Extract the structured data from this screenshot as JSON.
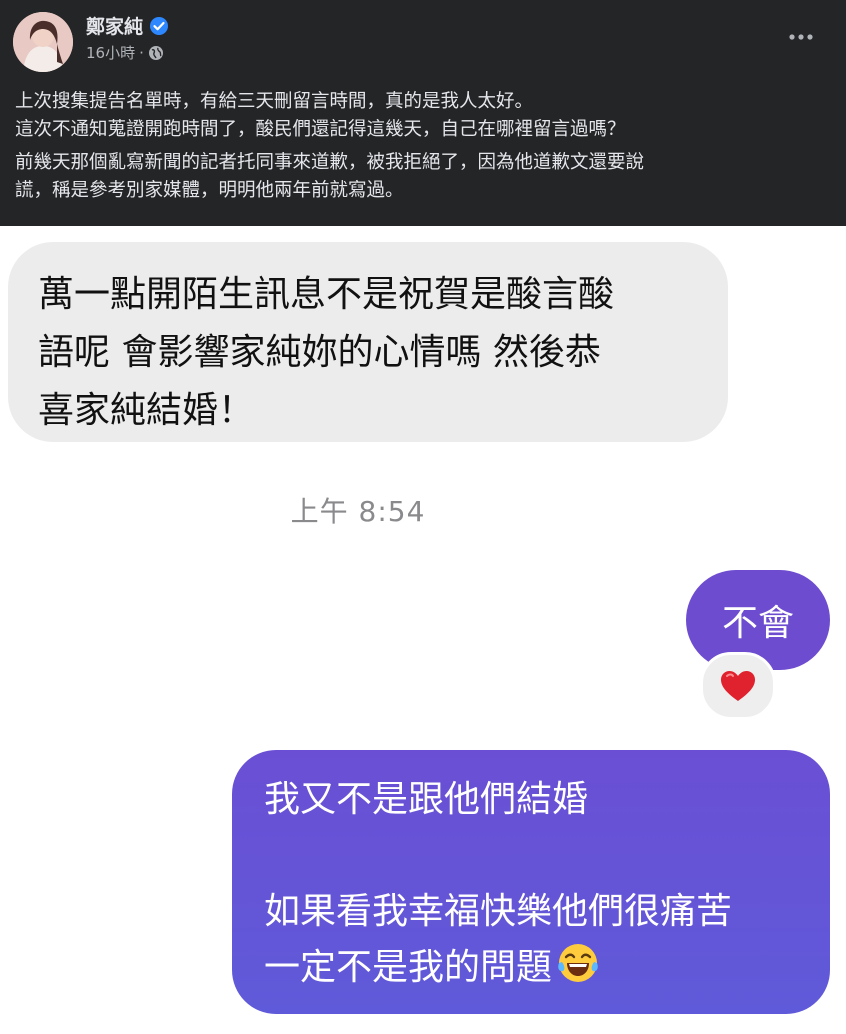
{
  "post": {
    "author": "鄭家純",
    "time": "16小時",
    "dot": "·",
    "paragraphs": [
      "上次搜集提告名單時，有給三天刪留言時間，真的是我人太好。\n這次不通知蒐證開跑時間了，酸民們還記得這幾天，自己在哪裡留言過嗎？",
      "前幾天那個亂寫新聞的記者托同事來道歉，被我拒絕了，因為他道歉文還要說\n謊，稱是參考別家媒體，明明他兩年前就寫過。"
    ],
    "icons": [
      "verified-badge-icon",
      "globe-icon",
      "more-options-icon"
    ],
    "colors": {
      "background": "#242526",
      "text": "#e4e6eb",
      "muted": "#b0b3b8",
      "verified": "#2d88ff"
    }
  },
  "chat": {
    "incoming": "萬一點開陌生訊息不是祝賀是酸言酸\n語呢 會影響家純妳的心情嗎 然後恭\n喜家純結婚！",
    "timestamp": "上午 8:54",
    "reply_short": "不會",
    "reaction": "heart-reaction-icon",
    "reply_long": {
      "line1": "我又不是跟他們結婚",
      "line2": "如果看我幸福快樂他們很痛苦",
      "line3": "一定不是我的問題",
      "emoji": "laughing-tears-emoji"
    },
    "colors": {
      "incoming_bg": "#ececec",
      "outgoing_bg": "#6d4ccf",
      "timestamp": "#8a8a8d",
      "heart": "#e0212e"
    }
  }
}
